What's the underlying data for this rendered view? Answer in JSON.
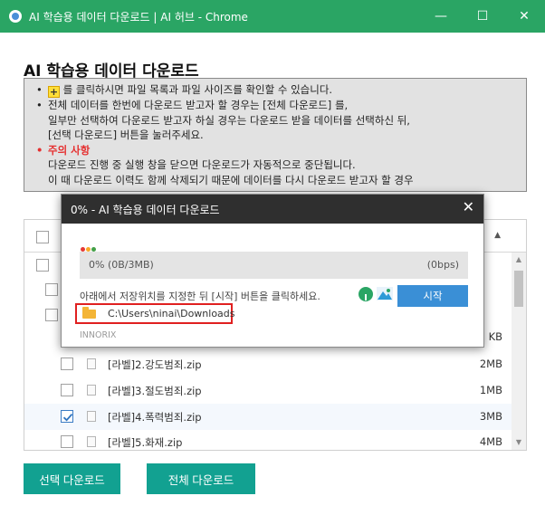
{
  "window": {
    "title": "AI 학습용 데이터 다운로드 | AI 허브 - Chrome",
    "minimize": "—",
    "maximize": "☐",
    "close": "✕"
  },
  "page": {
    "title": "AI 학습용 데이터 다운로드",
    "notice": {
      "line1_icon": "+",
      "line1": "를 클릭하시면 파일 목록과 파일 사이즈를 확인할 수 있습니다.",
      "line2": "전체 데이터를 한번에 다운로드 받고자 할 경우는 [전체 다운로드] 를,",
      "line2b": "일부만 선택하여 다운로드 받고자 하실 경우는 다운로드 받을 데이터를 선택하신 뒤,",
      "line2c": "[선택 다운로드] 버튼을 눌러주세요.",
      "warning_title": "주의 사항",
      "warning1": "다운로드 진행 중 실행 창을 닫으면 다운로드가 자동적으로 중단됩니다.",
      "warning2": "이 때 다운로드 이력도 함께 삭제되기 때문에 데이터를 다시 다운로드 받고자 할 경우"
    }
  },
  "list": {
    "sort_icon": "▲",
    "rows": [
      {
        "name": "[라벨]2.강도범죄.zip",
        "size": "2MB",
        "checked": false
      },
      {
        "name": "[라벨]3.절도범죄.zip",
        "size": "1MB",
        "checked": false
      },
      {
        "name": "[라벨]4.폭력범죄.zip",
        "size": "3MB",
        "checked": true
      },
      {
        "name": "[라벨]5.화재.zip",
        "size": "4MB",
        "checked": false
      }
    ],
    "partial_size": "KB"
  },
  "buttons": {
    "select_download": "선택 다운로드",
    "all_download": "전체 다운로드"
  },
  "dialog": {
    "title": "0% - AI 학습용 데이터 다운로드",
    "close": "✕",
    "progress_text": "0% (0B/3MB)",
    "progress_rate": "(0bps)",
    "progress_fraction": 0,
    "hint": "아래에서 저장위치를 지정한 뒤 [시작] 버튼을 클릭하세요.",
    "start_label": "시작",
    "path": "C:\\Users\\ninai\\Downloads",
    "brand": "INNORIX",
    "dot_colors": [
      "#e53935",
      "#f9a825",
      "#43a047"
    ]
  },
  "colors": {
    "titlebar": "#2aa564",
    "button": "#12a191",
    "start": "#3a8fd6",
    "warning": "#e53030"
  }
}
